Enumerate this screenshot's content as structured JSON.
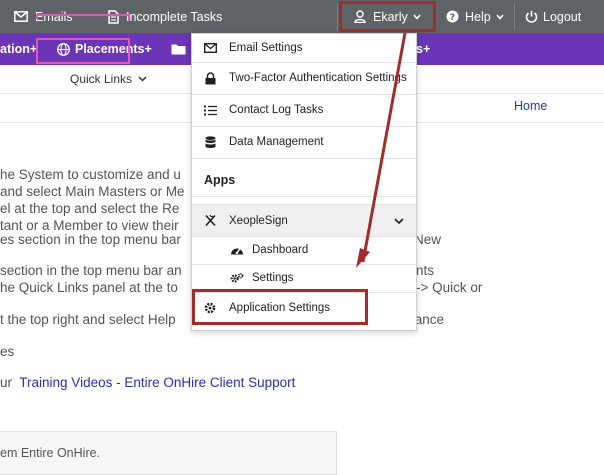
{
  "topbar": {
    "emails": "Emails",
    "incomplete_tasks": "Incomplete Tasks",
    "user": "Ekarly",
    "help": "Help",
    "logout": "Logout"
  },
  "navbar": {
    "left_partial": "ation+",
    "placements": "Placements+",
    "right_partial": "s+"
  },
  "quick_links": "Quick Links",
  "breadcrumb": {
    "home": "Home"
  },
  "content": {
    "line1": "he System to customize and u",
    "line2": "and select Main Masters or Me",
    "line3": "el at the top and select the Re",
    "line4": "tant or a Member to view their",
    "line5": "es section in the top menu bar",
    "line5_right": "New",
    "line6": "section in the top menu bar an",
    "line6_right": "nts",
    "line7": "he Quick Links panel at the to",
    "line7_right": "-> Quick or",
    "line8": "t the top right and select Help",
    "line8_right": "r assistance",
    "line9": "es",
    "line10_prefix": "ur",
    "line10_link": "Training Videos - Entire OnHire Client Support",
    "bottom": "em Entire OnHire."
  },
  "dropdown": {
    "email_settings": "Email Settings",
    "two_factor": "Two-Factor Authentication Settings",
    "contact_log_tasks": "Contact Log Tasks",
    "data_management": "Data Management",
    "apps_heading": "Apps",
    "xeoplesign": "XeopleSign",
    "dashboard": "Dashboard",
    "settings": "Settings",
    "application_settings": "Application Settings"
  },
  "colors": {
    "topbar": "#5f6368",
    "navbar": "#6b35b8",
    "highlight": "#a32b2b",
    "pink_highlight": "#e257b4",
    "link": "#2e2eb8"
  },
  "icons": {
    "emails": "envelope-icon",
    "incomplete_tasks": "document-icon",
    "user": "user-icon",
    "help": "question-circle-icon",
    "logout": "power-icon",
    "placements": "globe-icon",
    "folder": "folder-icon",
    "email_settings": "envelope-icon",
    "two_factor": "lock-icon",
    "contact_log_tasks": "list-icon",
    "data_management": "database-icon",
    "xeoplesign": "signature-icon",
    "dashboard": "gauge-icon",
    "settings": "gears-icon",
    "application_settings": "gear-icon"
  }
}
